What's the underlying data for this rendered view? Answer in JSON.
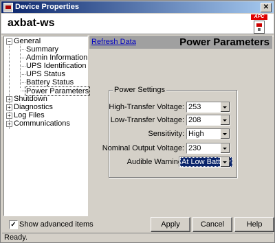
{
  "window": {
    "title": "Device Properties",
    "close_glyph": "✕"
  },
  "header": {
    "host": "axbat-ws",
    "logo_text": "APC"
  },
  "tree": {
    "expanded_glyph": "−",
    "collapsed_glyph": "+",
    "general": {
      "label": "General",
      "children": [
        "Summary",
        "Admin Information",
        "UPS Identification",
        "UPS Status",
        "Battery Status",
        "Power Parameters"
      ]
    },
    "others": [
      "Shutdown",
      "Diagnostics",
      "Log Files",
      "Communications"
    ]
  },
  "panel": {
    "refresh_label": "Refresh Data",
    "title": "Power Parameters"
  },
  "power_settings": {
    "title": "Power Settings",
    "fields": [
      {
        "label": "High-Transfer Voltage:",
        "value": "253"
      },
      {
        "label": "Low-Transfer Voltage:",
        "value": "208"
      },
      {
        "label": "Sensitivity:",
        "value": "High"
      },
      {
        "label": "Nominal Output Voltage:",
        "value": "230"
      },
      {
        "label": "Audible Warning:",
        "value": "At Low Battery"
      }
    ]
  },
  "footer": {
    "show_advanced_label": "Show advanced items",
    "show_advanced_checked": true,
    "check_glyph": "✓",
    "buttons": {
      "apply": "Apply",
      "cancel": "Cancel",
      "help": "Help"
    }
  },
  "status": {
    "text": "Ready."
  }
}
